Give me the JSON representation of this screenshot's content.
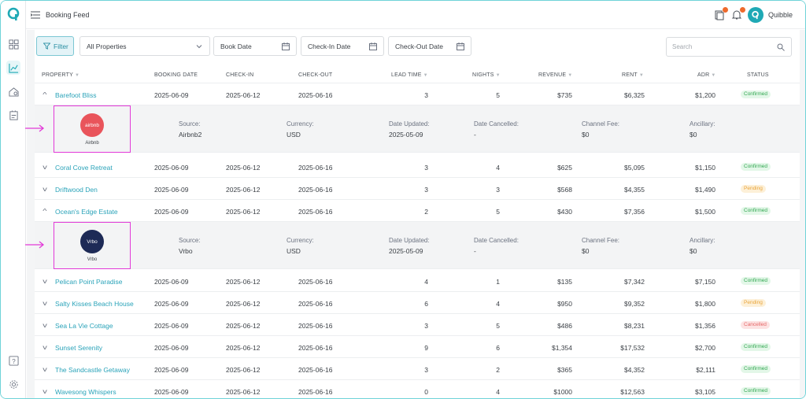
{
  "header": {
    "title": "Booking Feed",
    "user_name": "Quibble"
  },
  "filters": {
    "filter_label": "Filter",
    "properties_label": "All Properties",
    "book_date_label": "Book Date",
    "check_in_label": "Check-In Date",
    "check_out_label": "Check-Out Date",
    "search_placeholder": "Search"
  },
  "columns": {
    "property": "PROPERTY",
    "booking_date": "BOOKING DATE",
    "check_in": "CHECK-IN",
    "check_out": "CHECK-OUT",
    "lead_time": "LEAD TIME",
    "nights": "NIGHTS",
    "revenue": "REVENUE",
    "rent": "RENT",
    "adr": "ADR",
    "status": "STATUS"
  },
  "detail_labels": {
    "source": "Source:",
    "currency": "Currency:",
    "date_updated": "Date Updated:",
    "date_cancelled": "Date Cancelled:",
    "channel_fee": "Channel Fee:",
    "ancillary": "Ancillary:"
  },
  "rows": [
    {
      "property": "Barefoot Bliss",
      "booking_date": "2025-06-09",
      "check_in": "2025-06-12",
      "check_out": "2025-06-16",
      "lead_time": "3",
      "nights": "5",
      "revenue": "$735",
      "rent": "$6,325",
      "adr": "$1,200",
      "status": "Confirmed",
      "expanded": true,
      "chevron": "^"
    },
    {
      "property": "Coral Cove Retreat",
      "booking_date": "2025-06-09",
      "check_in": "2025-06-12",
      "check_out": "2025-06-16",
      "lead_time": "3",
      "nights": "4",
      "revenue": "$625",
      "rent": "$5,095",
      "adr": "$1,150",
      "status": "Confirmed",
      "expanded": false,
      "chevron": "v"
    },
    {
      "property": "Driftwood Den",
      "booking_date": "2025-06-09",
      "check_in": "2025-06-12",
      "check_out": "2025-06-16",
      "lead_time": "3",
      "nights": "3",
      "revenue": "$568",
      "rent": "$4,355",
      "adr": "$1,490",
      "status": "Pending",
      "expanded": false,
      "chevron": "v"
    },
    {
      "property": "Ocean's Edge Estate",
      "booking_date": "2025-06-09",
      "check_in": "2025-06-12",
      "check_out": "2025-06-16",
      "lead_time": "2",
      "nights": "5",
      "revenue": "$430",
      "rent": "$7,356",
      "adr": "$1,500",
      "status": "Confirmed",
      "expanded": true,
      "chevron": "^"
    },
    {
      "property": "Pelican Point Paradise",
      "booking_date": "2025-06-09",
      "check_in": "2025-06-12",
      "check_out": "2025-06-16",
      "lead_time": "4",
      "nights": "1",
      "revenue": "$135",
      "rent": "$7,342",
      "adr": "$7,150",
      "status": "Confirmed",
      "expanded": false,
      "chevron": "v"
    },
    {
      "property": "Salty Kisses Beach House",
      "booking_date": "2025-06-09",
      "check_in": "2025-06-12",
      "check_out": "2025-06-16",
      "lead_time": "6",
      "nights": "4",
      "revenue": "$950",
      "rent": "$9,352",
      "adr": "$1,800",
      "status": "Pending",
      "expanded": false,
      "chevron": "v"
    },
    {
      "property": "Sea La Vie Cottage",
      "booking_date": "2025-06-09",
      "check_in": "2025-06-12",
      "check_out": "2025-06-16",
      "lead_time": "3",
      "nights": "5",
      "revenue": "$486",
      "rent": "$8,231",
      "adr": "$1,356",
      "status": "Cancelled",
      "expanded": false,
      "chevron": "v"
    },
    {
      "property": "Sunset Serenity",
      "booking_date": "2025-06-09",
      "check_in": "2025-06-12",
      "check_out": "2025-06-16",
      "lead_time": "9",
      "nights": "6",
      "revenue": "$1,354",
      "rent": "$17,532",
      "adr": "$2,700",
      "status": "Confirmed",
      "expanded": false,
      "chevron": "v"
    },
    {
      "property": "The Sandcastle Getaway",
      "booking_date": "2025-06-09",
      "check_in": "2025-06-12",
      "check_out": "2025-06-16",
      "lead_time": "3",
      "nights": "2",
      "revenue": "$365",
      "rent": "$4,352",
      "adr": "$2,111",
      "status": "Confirmed",
      "expanded": false,
      "chevron": "v"
    },
    {
      "property": "Wavesong Whispers",
      "booking_date": "2025-06-09",
      "check_in": "2025-06-12",
      "check_out": "2025-06-16",
      "lead_time": "0",
      "nights": "4",
      "revenue": "$1000",
      "rent": "$12,563",
      "adr": "$3,105",
      "status": "Confirmed",
      "expanded": false,
      "chevron": "v"
    }
  ],
  "details": [
    {
      "brand": "Airbnb",
      "brand_mark": "airbnb",
      "brand_color": "#e9545b",
      "source": "Airbnb2",
      "currency": "USD",
      "date_updated": "2025-05-09",
      "date_cancelled": "-",
      "channel_fee": "$0",
      "ancillary": "$0"
    },
    {
      "brand": "Vrbo",
      "brand_mark": "Vrbo",
      "brand_color": "#1d2a56",
      "source": "Vrbo",
      "currency": "USD",
      "date_updated": "2025-05-09",
      "date_cancelled": "-",
      "channel_fee": "$0",
      "ancillary": "$0"
    }
  ],
  "colors": {
    "accent": "#2aa3b9",
    "highlight": "#e23ad8",
    "confirmed": "#34a853",
    "pending": "#e9a53b",
    "cancelled": "#e56a6a"
  },
  "icons": [
    "dashboard-icon",
    "chart-icon",
    "property-icon",
    "booking-icon",
    "help-icon",
    "settings-icon",
    "menu-icon",
    "notes-icon",
    "bell-icon",
    "search-icon",
    "calendar-icon",
    "filter-icon"
  ]
}
